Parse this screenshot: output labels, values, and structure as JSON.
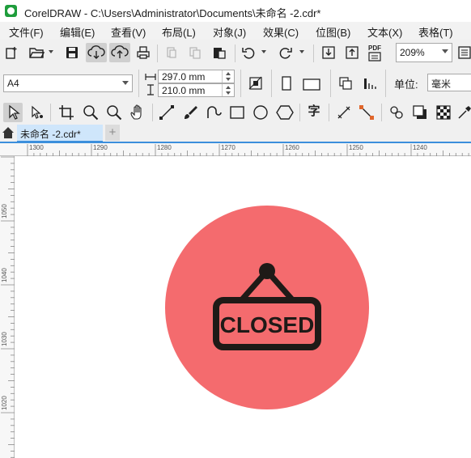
{
  "window": {
    "title": "CorelDRAW - C:\\Users\\Administrator\\Documents\\未命名 -2.cdr*"
  },
  "menu": [
    {
      "label": "文件(F)"
    },
    {
      "label": "编辑(E)"
    },
    {
      "label": "查看(V)"
    },
    {
      "label": "布局(L)"
    },
    {
      "label": "对象(J)"
    },
    {
      "label": "效果(C)"
    },
    {
      "label": "位图(B)"
    },
    {
      "label": "文本(X)"
    },
    {
      "label": "表格(T)"
    }
  ],
  "toolbar": {
    "zoom_value": "209%",
    "pdf_label": "PDF"
  },
  "property_bar": {
    "page_size": "A4",
    "width_value": "297.0 mm",
    "height_value": "210.0 mm",
    "unit_label": "单位:",
    "unit_value": "毫米"
  },
  "toolbox": {
    "text_tool_glyph": "字"
  },
  "tabs": {
    "document_tab": "未命名 -2.cdr*",
    "add_tab": "+"
  },
  "ruler": {
    "horizontal_labels": [
      "1300",
      "1290",
      "1280",
      "1270",
      "1260",
      "1250",
      "1240"
    ],
    "vertical_labels": [
      "1050",
      "1040",
      "1030",
      "1020"
    ]
  },
  "artwork": {
    "sign_text": "CLOSED",
    "circle_color": "#f46b6e",
    "sign_color": "#1f1a17"
  }
}
